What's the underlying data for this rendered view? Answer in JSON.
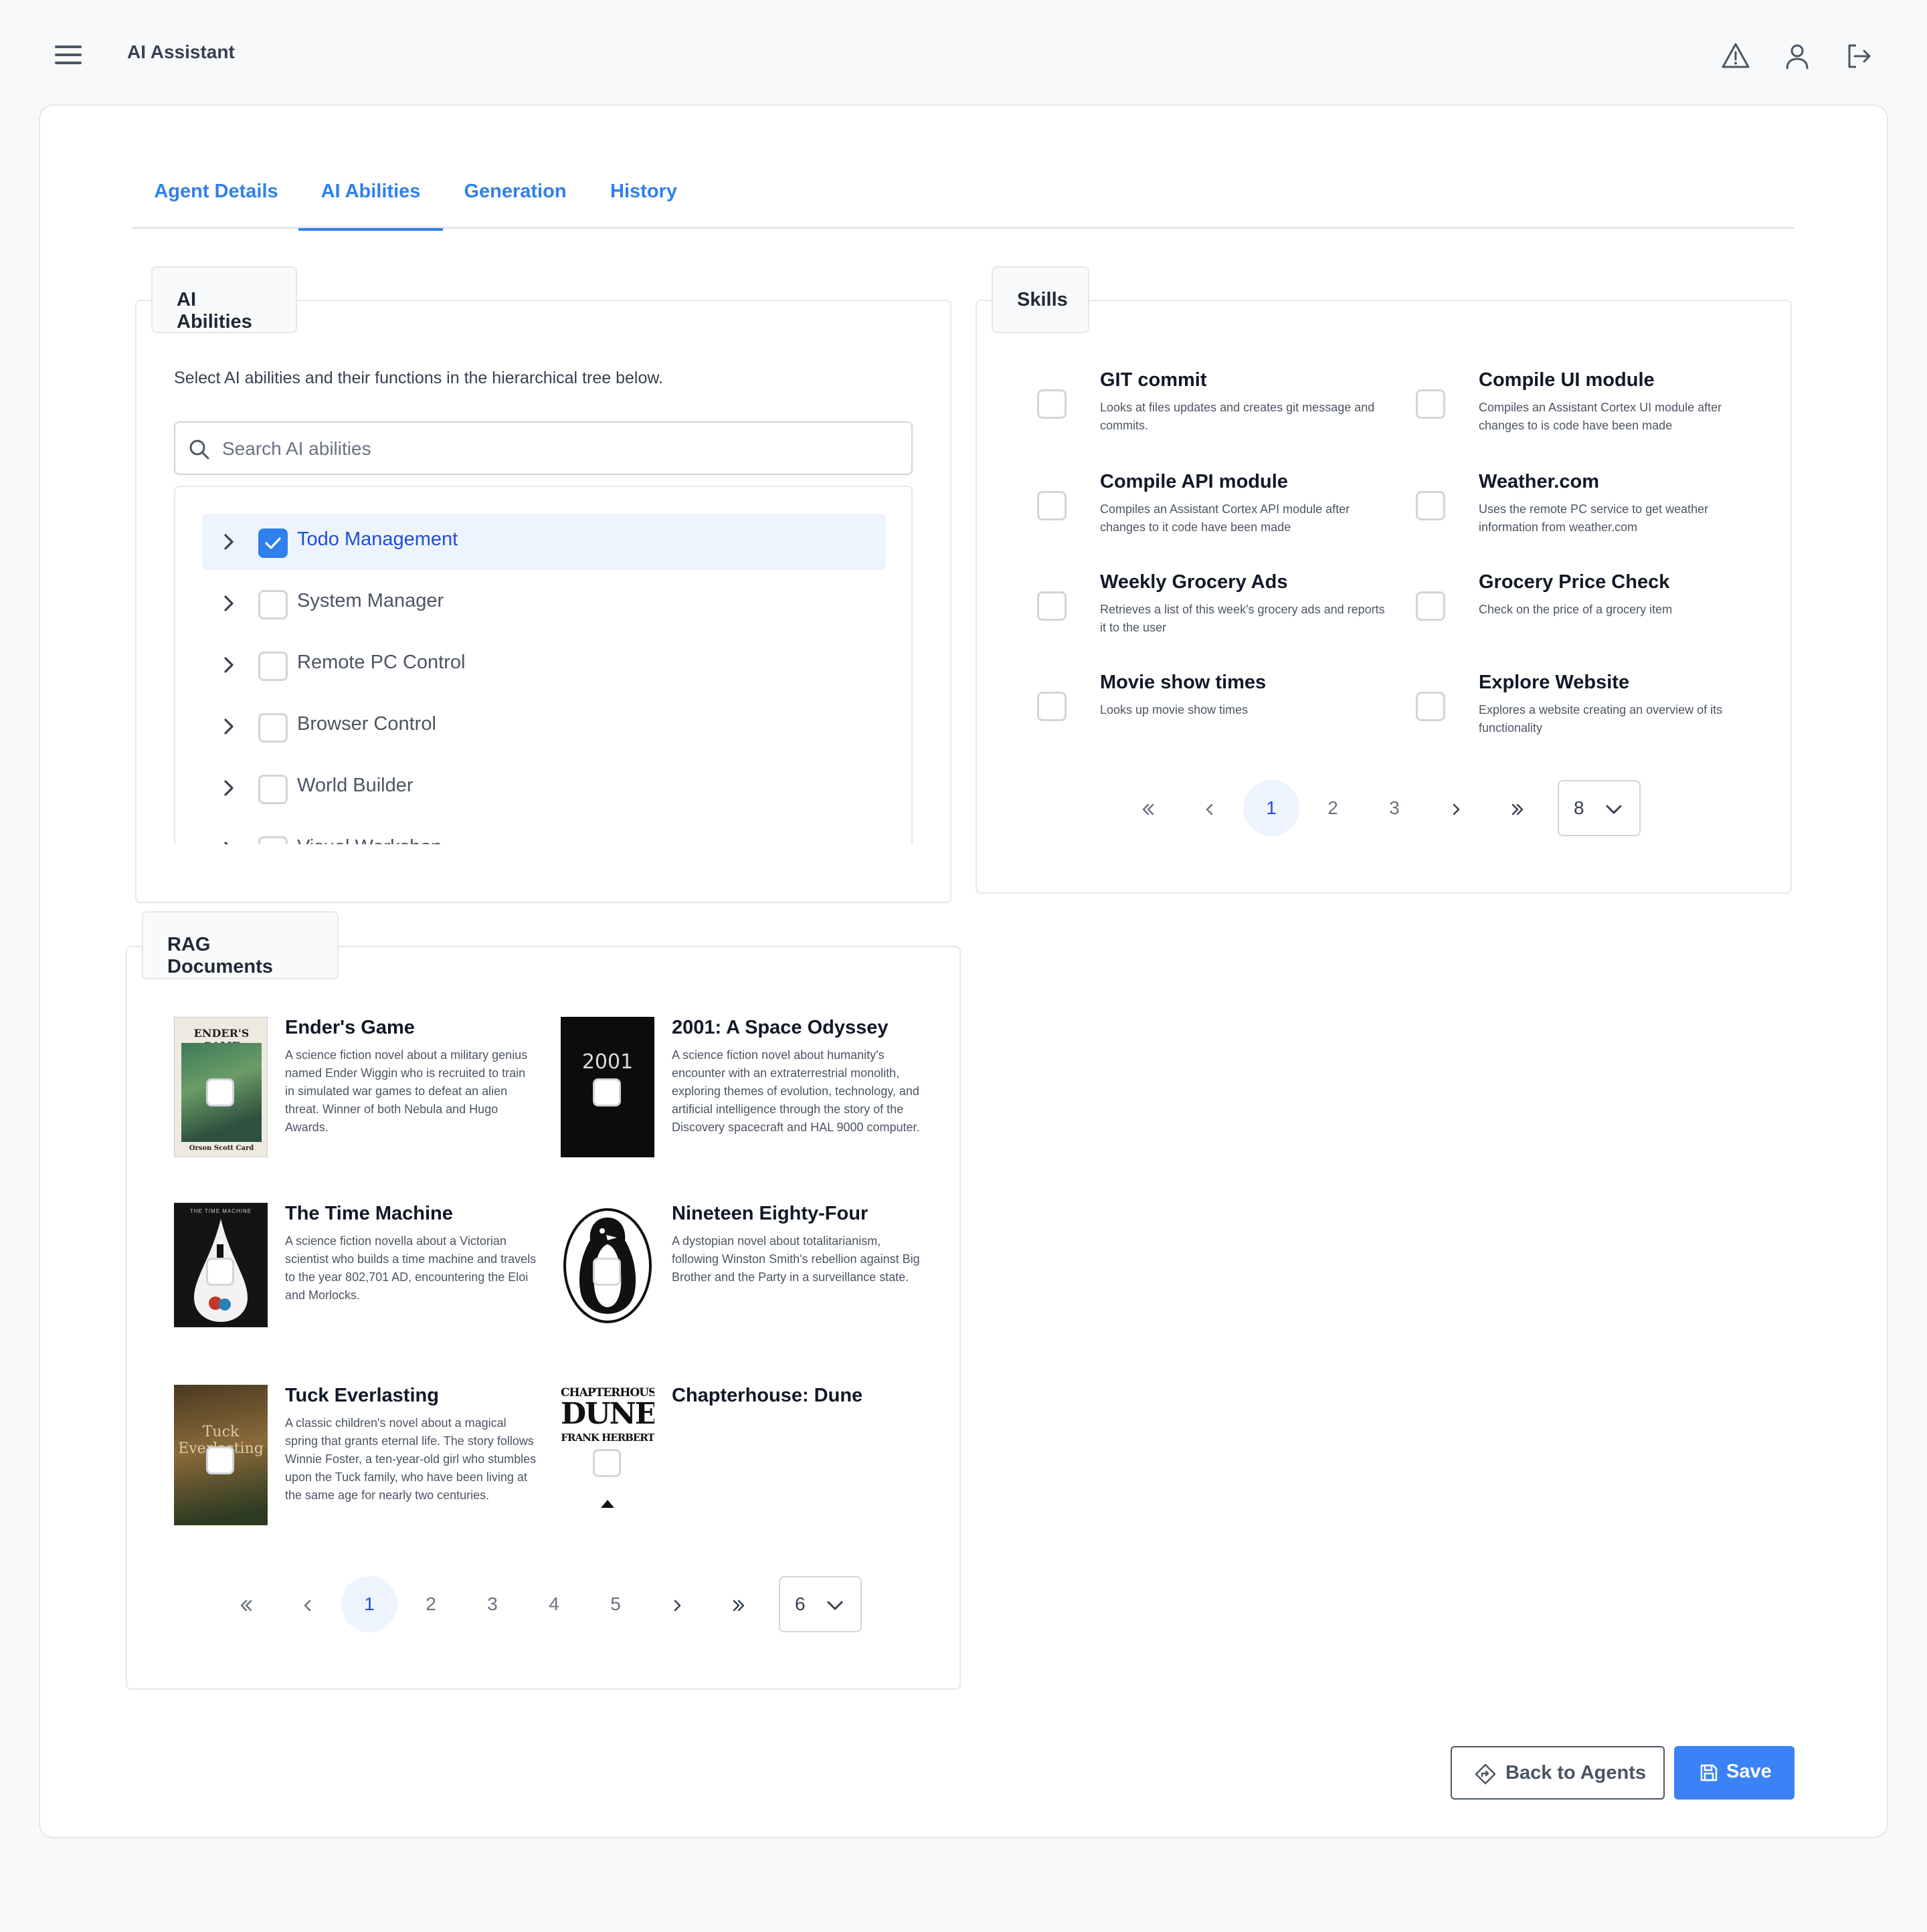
{
  "app": {
    "title": "AI Assistant"
  },
  "tabs": [
    {
      "label": "Agent Details"
    },
    {
      "label": "AI Abilities"
    },
    {
      "label": "Generation"
    },
    {
      "label": "History"
    }
  ],
  "abilities": {
    "title": "AI Abilities",
    "description": "Select AI abilities and their functions in the hierarchical tree below.",
    "search_placeholder": "Search AI abilities",
    "items": [
      {
        "label": "Todo Management",
        "checked": true
      },
      {
        "label": "System Manager",
        "checked": false
      },
      {
        "label": "Remote PC Control",
        "checked": false
      },
      {
        "label": "Browser Control",
        "checked": false
      },
      {
        "label": "World Builder",
        "checked": false
      },
      {
        "label": "Visual Workshop",
        "checked": false
      }
    ]
  },
  "skills": {
    "title": "Skills",
    "items": [
      {
        "name": "GIT commit",
        "desc": "Looks at files updates and creates git message and commits."
      },
      {
        "name": "Compile UI module",
        "desc": "Compiles an Assistant Cortex UI module after changes to is code have been made"
      },
      {
        "name": "Compile API module",
        "desc": "Compiles an Assistant Cortex API module after changes to it code have been made"
      },
      {
        "name": "Weather.com",
        "desc": "Uses the remote PC service to get weather information from weather.com"
      },
      {
        "name": "Weekly Grocery Ads",
        "desc": "Retrieves a list of this week's grocery ads and reports it to the user"
      },
      {
        "name": "Grocery Price Check",
        "desc": "Check on the price of a grocery item"
      },
      {
        "name": "Movie show times",
        "desc": "Looks up movie show times"
      },
      {
        "name": "Explore Website",
        "desc": "Explores a website creating an overview of its functionality"
      }
    ],
    "pager": {
      "pages": [
        "1",
        "2",
        "3"
      ],
      "current": "1",
      "rows": "8"
    }
  },
  "rag": {
    "title": "RAG Documents",
    "items": [
      {
        "title": "Ender's Game",
        "desc": "A science fiction novel about a military genius named Ender Wiggin who is recruited to train in simulated war games to defeat an alien threat. Winner of both Nebula and Hugo Awards.",
        "cover_top": "ENDER'S GAME",
        "cover_bottom": "Orson Scott Card"
      },
      {
        "title": "2001: A Space Odyssey",
        "desc": "A science fiction novel about humanity's encounter with an extraterrestrial monolith, exploring themes of evolution, technology, and artificial intelligence through the story of the Discovery spacecraft and HAL 9000 computer.",
        "cover_top": "2001"
      },
      {
        "title": "The Time Machine",
        "desc": "A science fiction novella about a Victorian scientist who builds a time machine and travels to the year 802,701 AD, encountering the Eloi and Morlocks.",
        "cover_top": "THE TIME MACHINE"
      },
      {
        "title": "Nineteen Eighty-Four",
        "desc": "A dystopian novel about totalitarianism, following Winston Smith's rebellion against Big Brother and the Party in a surveillance state."
      },
      {
        "title": "Tuck Everlasting",
        "desc": "A classic children's novel about a magical spring that grants eternal life. The story follows Winnie Foster, a ten-year-old girl who stumbles upon the Tuck family, who have been living at the same age for nearly two centuries.",
        "cover_top": "Tuck Everlasting"
      },
      {
        "title": "Chapterhouse: Dune",
        "desc": "",
        "cover_top": "CHAPTERHOUSE:",
        "cover_mid": "DUNE",
        "cover_bottom": "FRANK HERBERT"
      }
    ],
    "pager": {
      "pages": [
        "1",
        "2",
        "3",
        "4",
        "5"
      ],
      "current": "1",
      "rows": "6"
    }
  },
  "actions": {
    "back_label": "Back to Agents",
    "save_label": "Save"
  },
  "colors": {
    "accent": "#2f80ed",
    "save_bg": "#3b82f6",
    "selected_bg": "#eef4fe"
  }
}
